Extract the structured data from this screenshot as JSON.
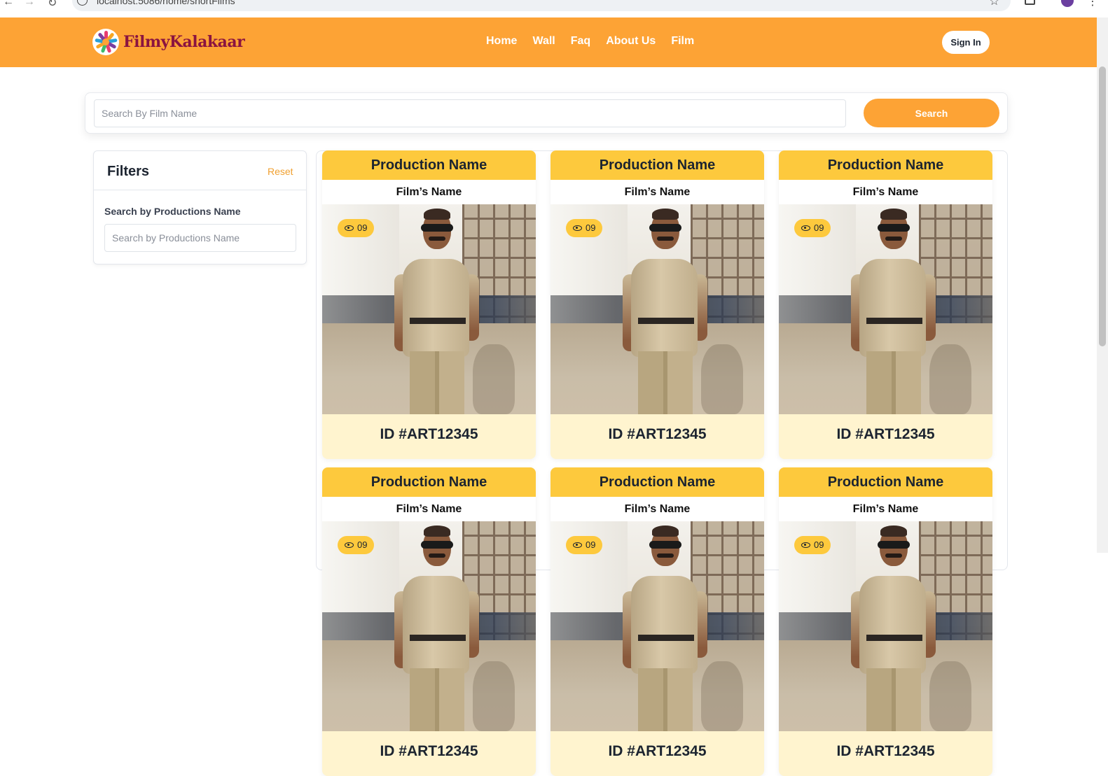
{
  "browser": {
    "url": "localhost:5086/home/shortFilms"
  },
  "header": {
    "brand": "FilmyKalakaar",
    "nav": [
      "Home",
      "Wall",
      "Faq",
      "About Us",
      "Film"
    ],
    "signin_label": "Sign In",
    "colors": {
      "header_bg": "#fda335",
      "brand_text": "#8b1440"
    }
  },
  "search": {
    "placeholder": "Search By Film Name",
    "button_label": "Search"
  },
  "filters": {
    "title": "Filters",
    "reset_label": "Reset",
    "productions_label": "Search by Productions Name",
    "productions_placeholder": "Search by Productions Name"
  },
  "cards": [
    {
      "production": "Production Name",
      "film": "Film’s Name",
      "views": "09",
      "id": "ID #ART12345"
    },
    {
      "production": "Production Name",
      "film": "Film’s Name",
      "views": "09",
      "id": "ID #ART12345"
    },
    {
      "production": "Production Name",
      "film": "Film’s Name",
      "views": "09",
      "id": "ID #ART12345"
    },
    {
      "production": "Production Name",
      "film": "Film’s Name",
      "views": "09",
      "id": "ID #ART12345"
    },
    {
      "production": "Production Name",
      "film": "Film’s Name",
      "views": "09",
      "id": "ID #ART12345"
    },
    {
      "production": "Production Name",
      "film": "Film’s Name",
      "views": "09",
      "id": "ID #ART12345"
    }
  ],
  "icons": {
    "views": "eye-icon",
    "logo": "flower-logo-icon"
  },
  "colors": {
    "accent": "#fda335",
    "card_header": "#fdc93d",
    "card_body": "#fff4cf"
  }
}
